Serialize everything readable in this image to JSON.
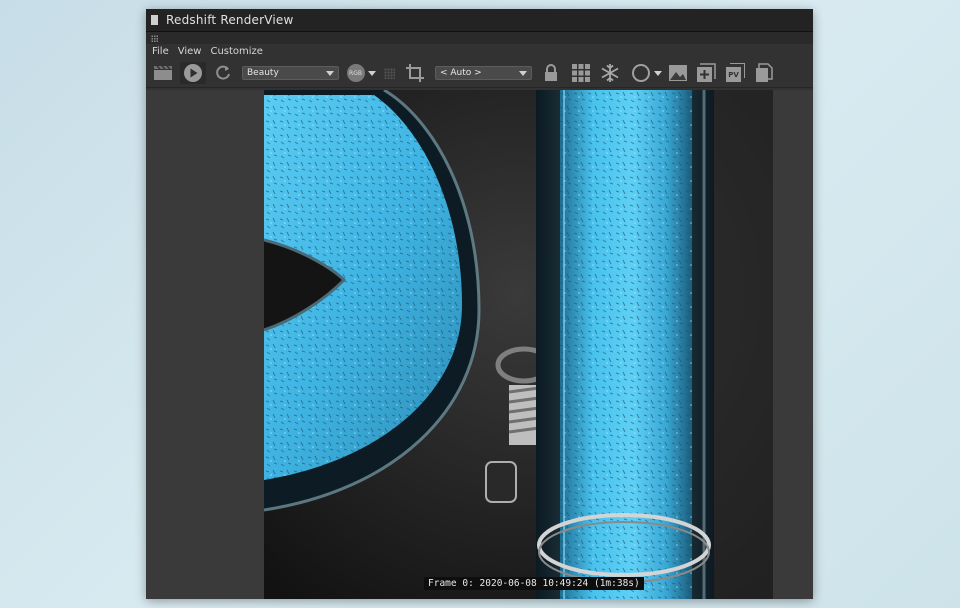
{
  "window": {
    "title": "Redshift RenderView"
  },
  "menu": [
    "File",
    "View",
    "Customize"
  ],
  "toolbar": {
    "aov_select": "Beauty",
    "channel_badge": "RGB",
    "crop_select": "< Auto >",
    "pv_label": "PV"
  },
  "status": {
    "frame_label": "Frame",
    "frame_number": "0:",
    "date": "2020-06-08",
    "time": "10:49:24",
    "duration": "(1m:38s)"
  },
  "colors": {
    "accent_blue": "#3fb6e6",
    "window_bg": "#323232",
    "titlebar_bg": "#232323"
  },
  "icons": [
    "clapperboard-icon",
    "play-icon",
    "refresh-icon",
    "rgb-channel-icon",
    "grid-dots-icon",
    "crop-icon",
    "lock-icon",
    "grid-icon",
    "snowflake-icon",
    "circle-icon",
    "image-icon",
    "image-add-icon",
    "pv-icon",
    "copy-icon"
  ]
}
